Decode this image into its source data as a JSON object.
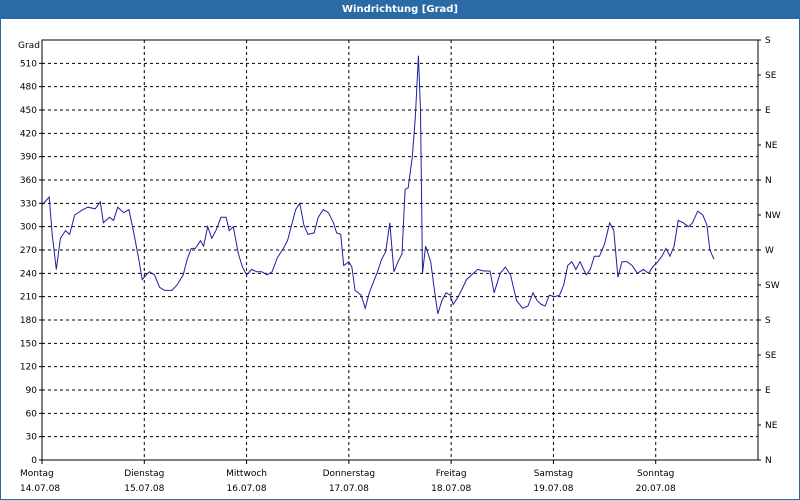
{
  "window": {
    "title": "Windrichtung [Grad]"
  },
  "colors": {
    "title_bar": "#2a6aa5",
    "line": "#1f1f9e",
    "grid": "#000000"
  },
  "chart_data": {
    "type": "line",
    "title": "Windrichtung [Grad]",
    "ylabel": "Grad",
    "ylim": [
      0,
      540
    ],
    "yticks": [
      0,
      30,
      60,
      90,
      120,
      150,
      180,
      210,
      240,
      270,
      300,
      330,
      360,
      390,
      420,
      450,
      480,
      510
    ],
    "right_axis_labels": [
      "N",
      "NE",
      "E",
      "SE",
      "S",
      "SW",
      "W",
      "NW",
      "N",
      "NE",
      "E",
      "SE",
      "S"
    ],
    "grid": true,
    "days": [
      {
        "name": "Montag",
        "date": "14.07.08"
      },
      {
        "name": "Dienstag",
        "date": "15.07.08"
      },
      {
        "name": "Mittwoch",
        "date": "16.07.08"
      },
      {
        "name": "Donnerstag",
        "date": "17.07.08"
      },
      {
        "name": "Freitag",
        "date": "18.07.08"
      },
      {
        "name": "Samstag",
        "date": "19.07.08"
      },
      {
        "name": "Sonntag",
        "date": "20.07.08"
      }
    ],
    "xlim": [
      0,
      7
    ],
    "series": [
      {
        "points": [
          [
            0.0,
            328
          ],
          [
            0.07,
            338
          ],
          [
            0.1,
            290
          ],
          [
            0.14,
            245
          ],
          [
            0.18,
            285
          ],
          [
            0.23,
            295
          ],
          [
            0.27,
            290
          ],
          [
            0.32,
            315
          ],
          [
            0.4,
            322
          ],
          [
            0.45,
            325
          ],
          [
            0.52,
            323
          ],
          [
            0.57,
            332
          ],
          [
            0.6,
            305
          ],
          [
            0.66,
            312
          ],
          [
            0.7,
            308
          ],
          [
            0.74,
            325
          ],
          [
            0.8,
            318
          ],
          [
            0.85,
            322
          ],
          [
            0.9,
            290
          ],
          [
            0.95,
            255
          ],
          [
            0.98,
            232
          ],
          [
            1.02,
            238
          ],
          [
            1.05,
            242
          ],
          [
            1.1,
            238
          ],
          [
            1.15,
            222
          ],
          [
            1.2,
            218
          ],
          [
            1.27,
            218
          ],
          [
            1.32,
            225
          ],
          [
            1.38,
            238
          ],
          [
            1.42,
            258
          ],
          [
            1.46,
            272
          ],
          [
            1.5,
            272
          ],
          [
            1.55,
            282
          ],
          [
            1.58,
            275
          ],
          [
            1.62,
            300
          ],
          [
            1.66,
            285
          ],
          [
            1.7,
            295
          ],
          [
            1.75,
            312
          ],
          [
            1.8,
            312
          ],
          [
            1.83,
            295
          ],
          [
            1.87,
            300
          ],
          [
            1.92,
            265
          ],
          [
            1.96,
            248
          ],
          [
            2.0,
            238
          ],
          [
            2.05,
            245
          ],
          [
            2.1,
            242
          ],
          [
            2.15,
            242
          ],
          [
            2.2,
            238
          ],
          [
            2.25,
            242
          ],
          [
            2.3,
            260
          ],
          [
            2.36,
            272
          ],
          [
            2.4,
            282
          ],
          [
            2.44,
            302
          ],
          [
            2.48,
            322
          ],
          [
            2.52,
            330
          ],
          [
            2.56,
            302
          ],
          [
            2.6,
            290
          ],
          [
            2.66,
            292
          ],
          [
            2.7,
            312
          ],
          [
            2.75,
            322
          ],
          [
            2.8,
            318
          ],
          [
            2.85,
            305
          ],
          [
            2.88,
            292
          ],
          [
            2.92,
            290
          ],
          [
            2.95,
            250
          ],
          [
            3.0,
            255
          ],
          [
            3.03,
            248
          ],
          [
            3.06,
            218
          ],
          [
            3.12,
            212
          ],
          [
            3.16,
            195
          ],
          [
            3.2,
            215
          ],
          [
            3.25,
            232
          ],
          [
            3.28,
            242
          ],
          [
            3.32,
            258
          ],
          [
            3.36,
            268
          ],
          [
            3.4,
            305
          ],
          [
            3.44,
            242
          ],
          [
            3.48,
            255
          ],
          [
            3.52,
            265
          ],
          [
            3.55,
            348
          ],
          [
            3.58,
            350
          ],
          [
            3.62,
            390
          ],
          [
            3.65,
            440
          ],
          [
            3.68,
            520
          ],
          [
            3.7,
            450
          ],
          [
            3.72,
            240
          ],
          [
            3.75,
            275
          ],
          [
            3.8,
            255
          ],
          [
            3.84,
            215
          ],
          [
            3.87,
            188
          ],
          [
            3.91,
            205
          ],
          [
            3.95,
            215
          ],
          [
            3.99,
            212
          ],
          [
            4.02,
            200
          ],
          [
            4.06,
            208
          ],
          [
            4.1,
            218
          ],
          [
            4.15,
            232
          ],
          [
            4.2,
            238
          ],
          [
            4.26,
            245
          ],
          [
            4.32,
            243
          ],
          [
            4.38,
            243
          ],
          [
            4.42,
            215
          ],
          [
            4.48,
            240
          ],
          [
            4.53,
            248
          ],
          [
            4.58,
            238
          ],
          [
            4.64,
            205
          ],
          [
            4.7,
            195
          ],
          [
            4.75,
            198
          ],
          [
            4.8,
            215
          ],
          [
            4.84,
            205
          ],
          [
            4.88,
            200
          ],
          [
            4.92,
            198
          ],
          [
            4.96,
            212
          ],
          [
            5.01,
            210
          ],
          [
            5.06,
            212
          ],
          [
            5.1,
            225
          ],
          [
            5.14,
            250
          ],
          [
            5.18,
            255
          ],
          [
            5.22,
            245
          ],
          [
            5.26,
            255
          ],
          [
            5.32,
            238
          ],
          [
            5.36,
            245
          ],
          [
            5.4,
            262
          ],
          [
            5.45,
            262
          ],
          [
            5.5,
            278
          ],
          [
            5.55,
            305
          ],
          [
            5.59,
            295
          ],
          [
            5.63,
            235
          ],
          [
            5.67,
            255
          ],
          [
            5.72,
            255
          ],
          [
            5.77,
            250
          ],
          [
            5.82,
            240
          ],
          [
            5.88,
            245
          ],
          [
            5.93,
            240
          ],
          [
            5.97,
            248
          ],
          [
            6.02,
            255
          ],
          [
            6.06,
            262
          ],
          [
            6.1,
            272
          ],
          [
            6.14,
            262
          ],
          [
            6.18,
            275
          ],
          [
            6.22,
            308
          ],
          [
            6.27,
            305
          ],
          [
            6.32,
            300
          ],
          [
            6.36,
            305
          ],
          [
            6.41,
            320
          ],
          [
            6.46,
            315
          ],
          [
            6.5,
            302
          ],
          [
            6.53,
            270
          ],
          [
            6.57,
            258
          ]
        ]
      }
    ]
  }
}
